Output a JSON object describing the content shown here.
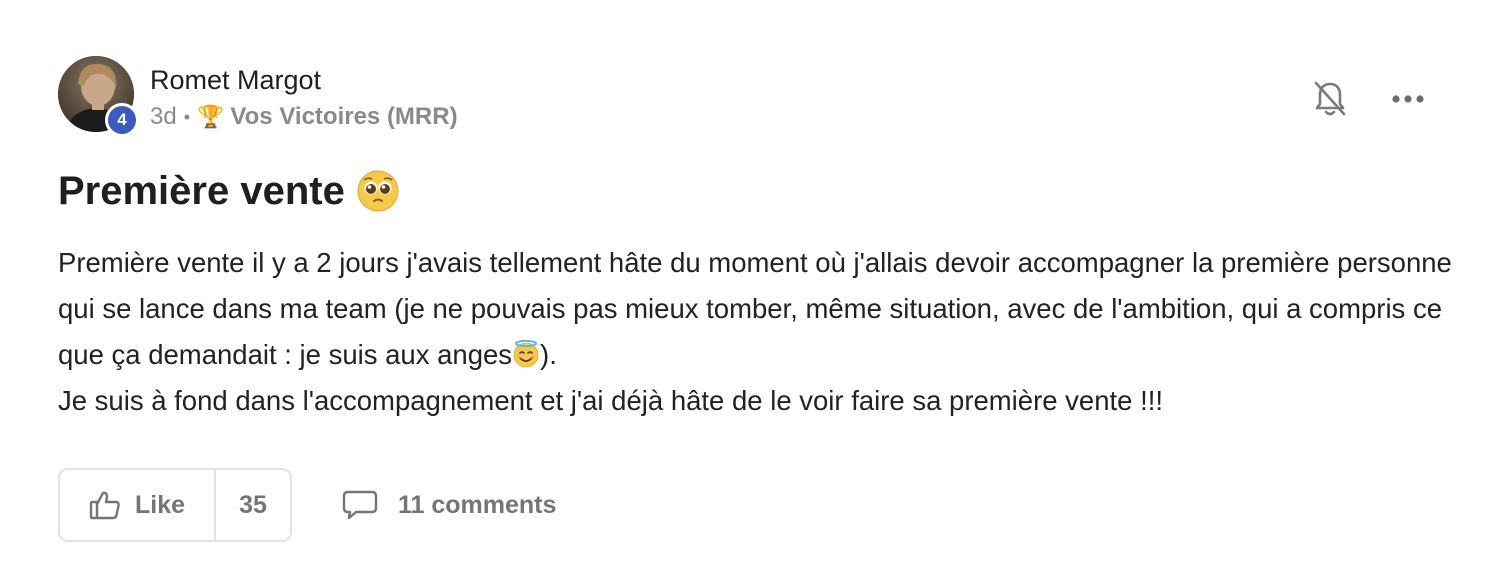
{
  "post": {
    "author": {
      "name": "Romet Margot",
      "level": "4",
      "avatar_icon": "profile-photo"
    },
    "meta": {
      "age": "3d",
      "separator": "•",
      "category_icon": "🏆",
      "category": "Vos Victoires (MRR)"
    },
    "title": "Première vente",
    "body": {
      "p1_part1": "Première vente il y a 2 jours j'avais tellement hâte du moment où j'allais devoir accompagner la première personne qui se lance dans ma team (je ne pouvais pas mieux tomber, même situation, avec de l'ambition, qui a compris ce que ça demandait : je suis aux anges",
      "p1_part2": ").",
      "p2": "Je suis à fond dans l'accompagnement et j'ai déjà hâte de le voir faire sa première vente !!!"
    },
    "footer": {
      "like_label": "Like",
      "like_count": "35",
      "comments_label": "11 comments"
    }
  },
  "colors": {
    "level_badge": "#3b5bbf",
    "text_primary": "#1f1f1f",
    "text_muted": "#8a8a8a",
    "border": "#e3e3e3"
  },
  "icons": {
    "bell": "bell-off-icon",
    "more": "more-horizontal-icon",
    "title_emoji": "pleading-face-emoji",
    "body_emoji": "smiling-face-with-halo-emoji",
    "like": "thumbs-up-icon",
    "comments": "comment-bubble-icon"
  }
}
